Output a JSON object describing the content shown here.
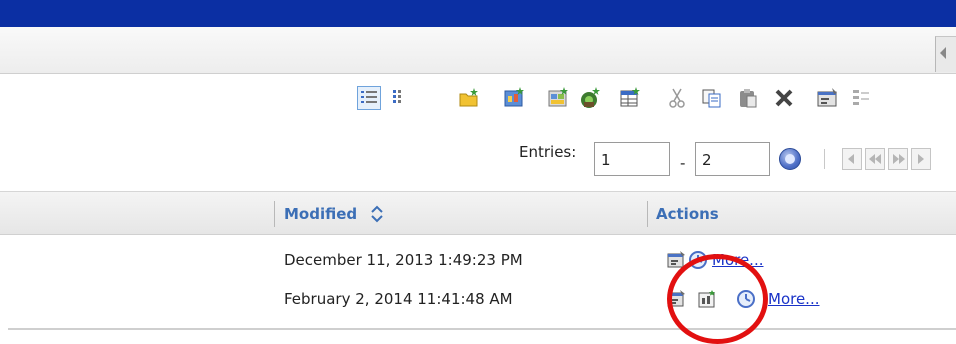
{
  "pagination": {
    "entries_label": "Entries:",
    "from_value": "1",
    "range_separator": "-",
    "to_value": "2"
  },
  "table": {
    "columns": [
      "Modified",
      "Actions"
    ],
    "rows": [
      {
        "modified": "December 11, 2013 1:49:23 PM",
        "action_link": "More..."
      },
      {
        "modified": "February 2, 2014 11:41:48 AM",
        "action_link": "More..."
      }
    ]
  },
  "toolbar_icons": [
    "list-view-icon",
    "details-view-icon",
    "new-folder-icon",
    "new-report-icon",
    "new-dashboard-icon",
    "new-job-icon",
    "new-table-icon",
    "cut-icon",
    "copy-icon",
    "paste-icon",
    "delete-icon",
    "properties-icon",
    "more-tools-icon"
  ],
  "colors": {
    "header_blue": "#0b2fa3",
    "link_blue": "#1a33c8",
    "column_header_text": "#3c6fb6",
    "highlight_circle": "#e21010"
  }
}
